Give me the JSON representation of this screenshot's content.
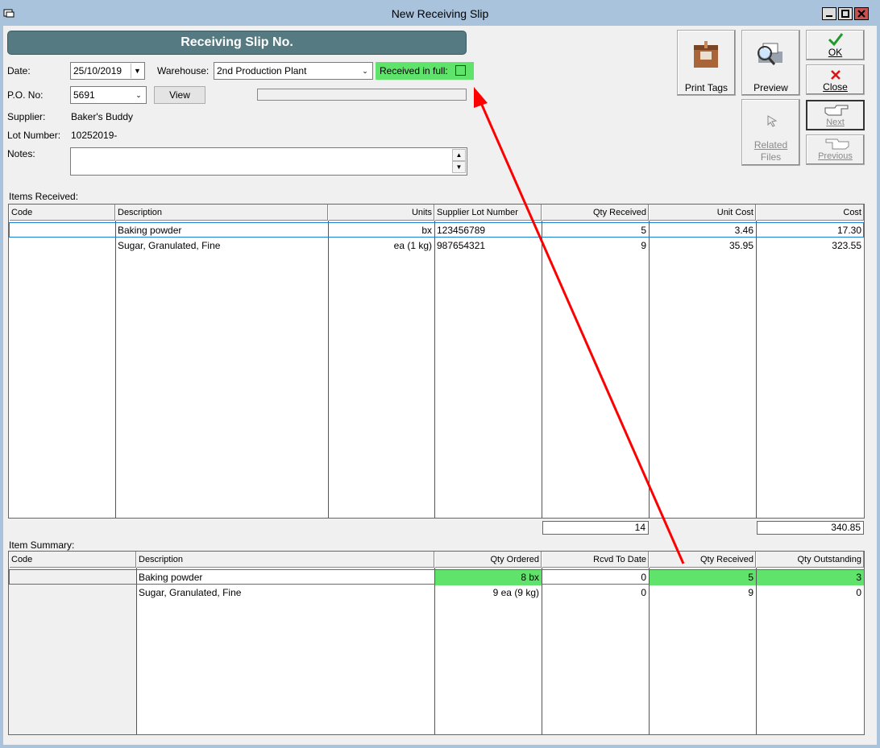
{
  "window": {
    "title": "New Receiving Slip"
  },
  "header": {
    "title": "Receiving Slip No."
  },
  "form": {
    "date_label": "Date:",
    "date_value": "25/10/2019",
    "warehouse_label": "Warehouse:",
    "warehouse_value": "2nd Production Plant",
    "received_in_full_label": "Received in full:",
    "po_label": "P.O. No:",
    "po_value": "5691",
    "view_label": "View",
    "supplier_label": "Supplier:",
    "supplier_value": "Baker's Buddy",
    "lot_label": "Lot Number:",
    "lot_value": "10252019-",
    "notes_label": "Notes:",
    "notes_value": ""
  },
  "toolbar": {
    "print_tags": "Print Tags",
    "preview": "Preview",
    "ok": "OK",
    "close": "Close",
    "related_files_1": "Related",
    "related_files_2": "Files",
    "next": "Next",
    "previous": "Previous"
  },
  "items_received": {
    "label": "Items Received:",
    "columns": [
      "Code",
      "Description",
      "Units",
      "Supplier Lot Number",
      "Qty Received",
      "Unit Cost",
      "Cost"
    ],
    "rows": [
      {
        "code": "",
        "description": "Baking powder",
        "units": "bx",
        "lot": "123456789",
        "qty": "5",
        "unit_cost": "3.46",
        "cost": "17.30"
      },
      {
        "code": "",
        "description": "Sugar, Granulated, Fine",
        "units": "ea (1 kg)",
        "lot": "987654321",
        "qty": "9",
        "unit_cost": "35.95",
        "cost": "323.55"
      }
    ],
    "total_qty": "14",
    "total_cost": "340.85"
  },
  "item_summary": {
    "label": "Item Summary:",
    "columns": [
      "Code",
      "Description",
      "Qty Ordered",
      "Rcvd To Date",
      "Qty Received",
      "Qty Outstanding"
    ],
    "rows": [
      {
        "code": "",
        "description": "Baking powder",
        "ordered": "8 bx",
        "to_date": "0",
        "received": "5",
        "outstanding": "3"
      },
      {
        "code": "",
        "description": "Sugar, Granulated, Fine",
        "ordered": "9 ea (9 kg)",
        "to_date": "0",
        "received": "9",
        "outstanding": "0"
      }
    ]
  },
  "colors": {
    "highlight": "#5fe36a",
    "annotation_arrow": "#ff0000",
    "header_bar": "#557a82"
  }
}
